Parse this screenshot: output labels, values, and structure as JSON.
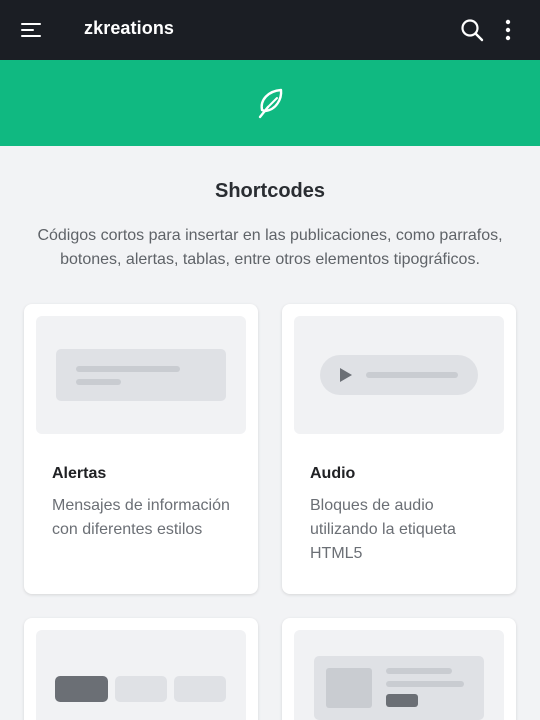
{
  "header": {
    "brand": "zkreations",
    "menu_icon": "menu-icon",
    "search_icon": "search-icon",
    "more_icon": "more-vertical-icon"
  },
  "hero": {
    "icon": "feather-icon",
    "color": "#10b981"
  },
  "section": {
    "title": "Shortcodes",
    "description": "Códigos cortos para insertar en las publicaciones, como parrafos, botones, alertas, tablas, entre otros elementos tipográficos."
  },
  "cards": [
    {
      "title": "Alertas",
      "description": "Mensajes de información con diferentes estilos",
      "illustration": "alert-illustration"
    },
    {
      "title": "Audio",
      "description": "Bloques de audio utilizando la etiqueta HTML5",
      "illustration": "audio-player-illustration"
    },
    {
      "title": "",
      "description": "",
      "illustration": "button-group-illustration"
    },
    {
      "title": "",
      "description": "",
      "illustration": "card-illustration"
    }
  ],
  "colors": {
    "topbar": "#1b1e24",
    "accent": "#10b981",
    "background": "#f2f3f5"
  }
}
